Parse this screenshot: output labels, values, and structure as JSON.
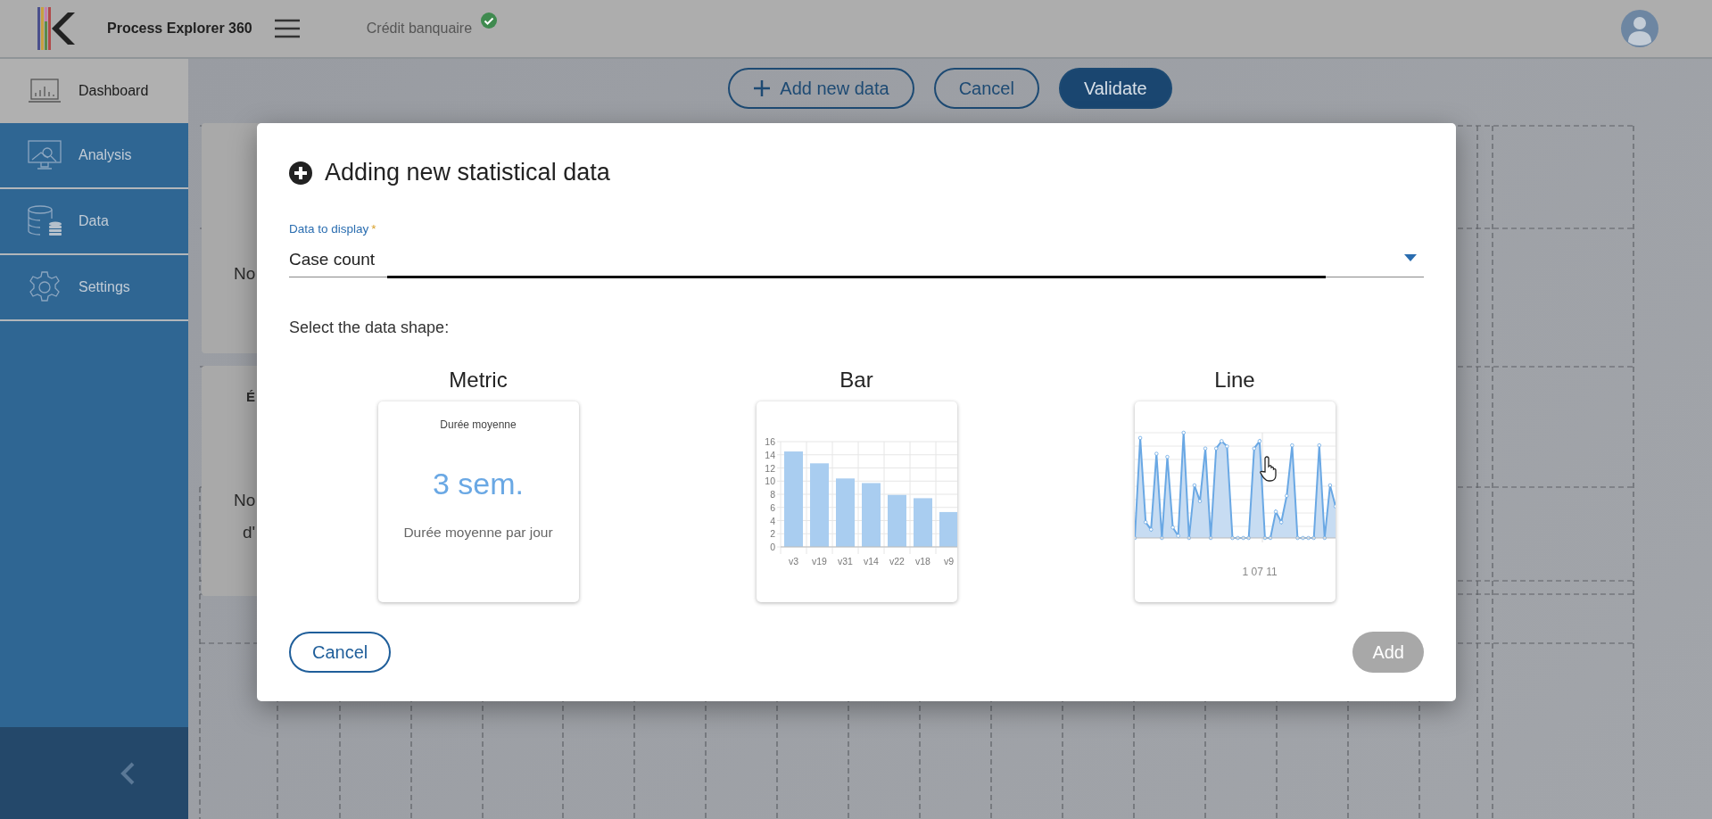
{
  "header": {
    "app_name": "Process Explorer 360",
    "project": "Crédit banquaire",
    "project_ok": true
  },
  "sidebar": {
    "items": [
      {
        "label": "Dashboard",
        "kind": "dashboard",
        "selected": true
      },
      {
        "label": "Analysis",
        "kind": "analysis",
        "selected": false
      },
      {
        "label": "Data",
        "kind": "data",
        "selected": false
      },
      {
        "label": "Settings",
        "kind": "settings",
        "selected": false
      }
    ]
  },
  "toolbar": {
    "buttons": [
      {
        "label": "Add new data",
        "kind": "add"
      },
      {
        "label": "Cancel",
        "kind": "outline"
      },
      {
        "label": "Validate",
        "kind": "primary"
      }
    ]
  },
  "background_cards": [
    {
      "lines": [
        "No"
      ]
    },
    {
      "title": "É",
      "lines": [
        "No",
        "d'"
      ]
    }
  ],
  "dialog": {
    "title": "Adding new statistical data",
    "field": {
      "label": "Data to display",
      "required_mark": "*",
      "value": "Case count"
    },
    "prompt": "Select the data shape:",
    "shapes": [
      {
        "kind": "metric",
        "label": "Metric",
        "card_title": "Durée moyenne",
        "value": "3 sem.",
        "caption": "Durée moyenne par jour"
      },
      {
        "kind": "bar",
        "label": "Bar",
        "chart_data": {
          "type": "bar",
          "categories": [
            "v3",
            "v19",
            "v31",
            "v14",
            "v22",
            "v18",
            "v9"
          ],
          "values": [
            14.5,
            12.7,
            10.4,
            9.7,
            7.9,
            7.4,
            5.3
          ],
          "ylim": [
            0,
            16
          ],
          "grid": true,
          "yticks": [
            0,
            2,
            4,
            6,
            8,
            10,
            12,
            14,
            16
          ]
        }
      },
      {
        "kind": "line",
        "label": "Line",
        "x_label": "1 07 11"
      }
    ],
    "cancel": "Cancel",
    "add": {
      "label": "Add",
      "disabled": true
    }
  }
}
